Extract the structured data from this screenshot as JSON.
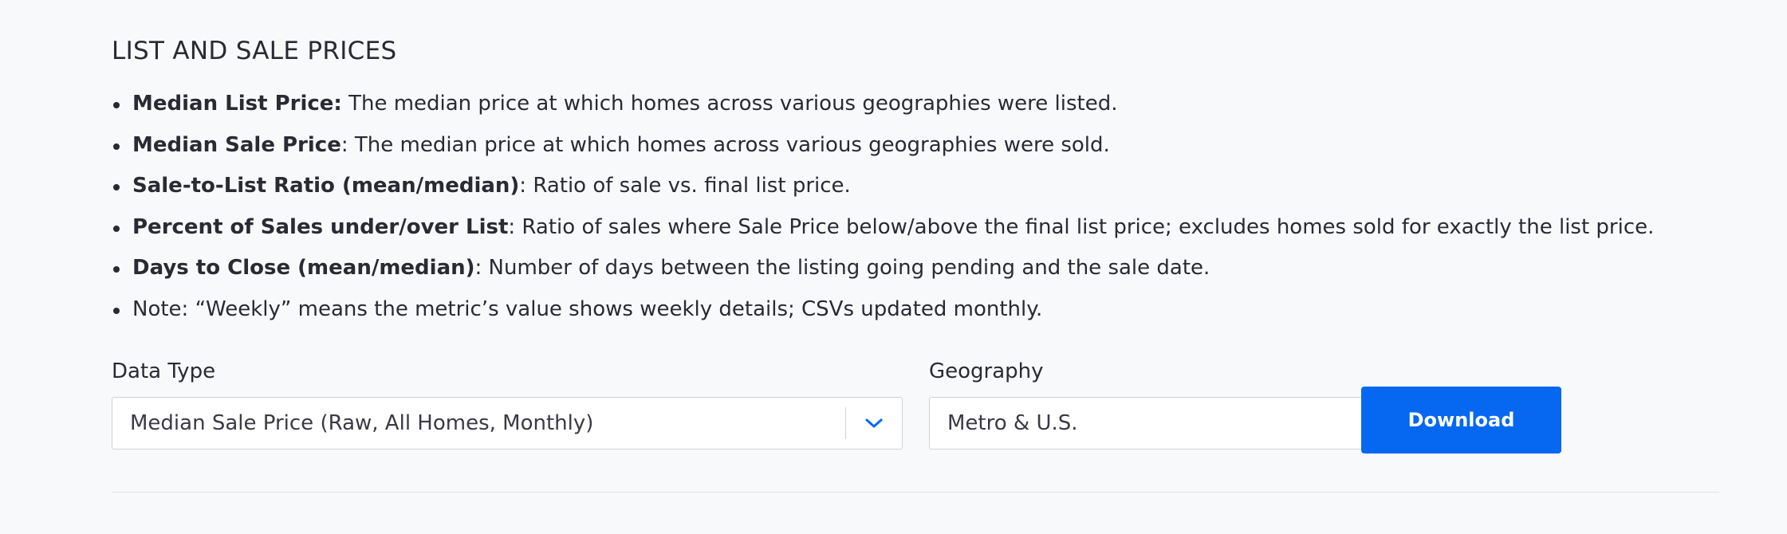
{
  "section": {
    "title": "LIST AND SALE PRICES"
  },
  "definitions": [
    {
      "term": "Median List Price:",
      "description": " The median price at which homes across various geographies were listed."
    },
    {
      "term": "Median Sale Price",
      "description": ": The median price at which homes across various geographies were sold."
    },
    {
      "term": "Sale-to-List Ratio (mean/median)",
      "description": ": Ratio of sale vs. final list price."
    },
    {
      "term": "Percent of Sales under/over List",
      "description": ": Ratio of sales where Sale Price below/above the final list price; excludes homes sold for exactly the list price."
    },
    {
      "term": "Days to Close (mean/median)",
      "description": ": Number of days between the listing going pending and the sale date."
    },
    {
      "term": "",
      "description": "Note: “Weekly” means the metric’s value shows weekly details; CSVs updated monthly."
    }
  ],
  "filters": {
    "data_type": {
      "label": "Data Type",
      "selected": "Median Sale Price (Raw, All Homes, Monthly)"
    },
    "geography": {
      "label": "Geography",
      "selected": "Metro & U.S."
    }
  },
  "actions": {
    "download_label": "Download"
  },
  "icons": {
    "dropdown": "chevron-down-icon"
  },
  "colors": {
    "accent": "#0668f0",
    "text": "#2a2a33",
    "background": "#f8f9fb",
    "border": "#d1d3d9"
  }
}
